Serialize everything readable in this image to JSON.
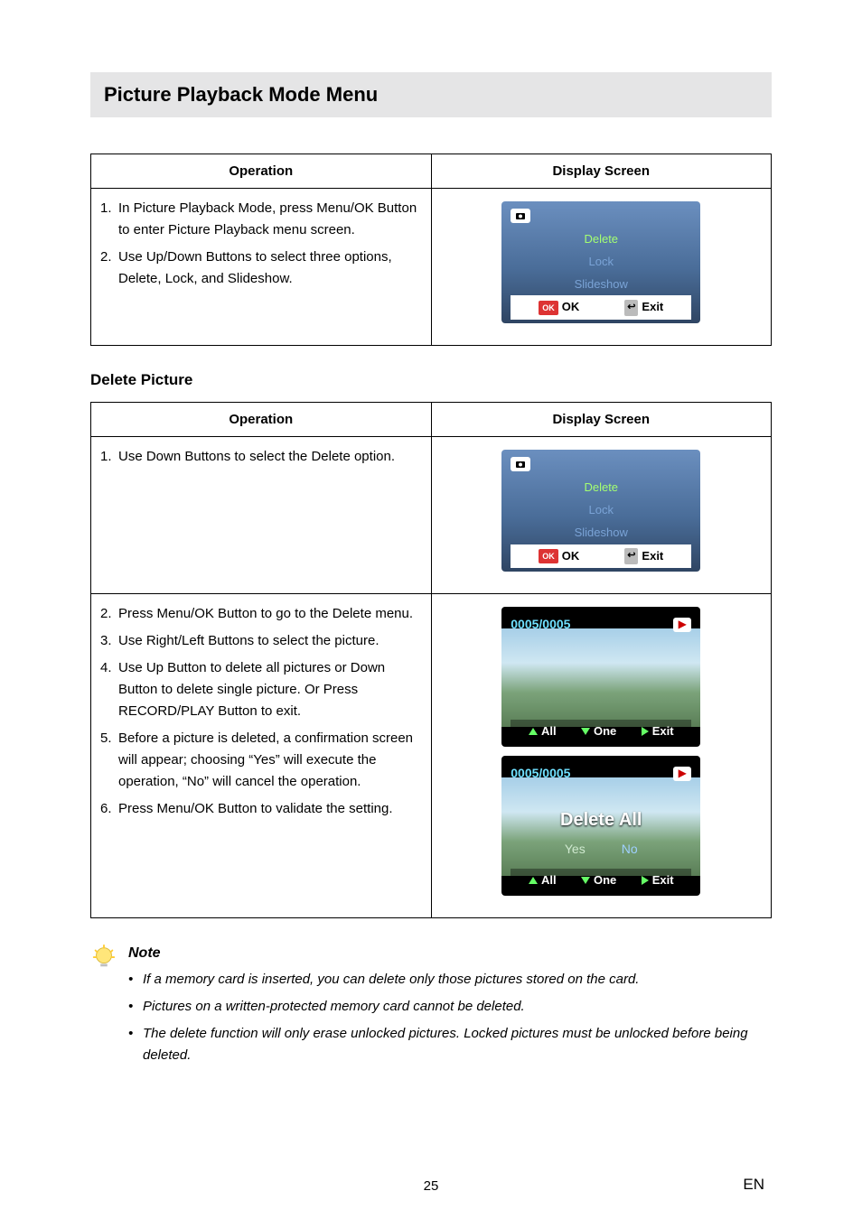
{
  "title": "Picture Playback Mode Menu",
  "headers": {
    "operation": "Operation",
    "display": "Display Screen"
  },
  "table1": {
    "steps": [
      {
        "n": "1.",
        "t": "In Picture Playback Mode, press Menu/OK Button to enter Picture Playback menu screen."
      },
      {
        "n": "2.",
        "t": "Use Up/Down Buttons to select three options, Delete, Lock, and Slideshow."
      }
    ],
    "screen": {
      "menu": [
        "Delete",
        "Lock",
        "Slideshow"
      ],
      "ok": "OK",
      "exit": "Exit",
      "okpill": "OK"
    }
  },
  "sub1": "Delete Picture",
  "table2": {
    "row1": {
      "steps": [
        {
          "n": "1.",
          "t": "Use Down Buttons to select the Delete option."
        }
      ],
      "screen": {
        "menu": [
          "Delete",
          "Lock",
          "Slideshow"
        ],
        "ok": "OK",
        "exit": "Exit",
        "okpill": "OK"
      }
    },
    "row2": {
      "steps": [
        {
          "n": "2.",
          "t": "Press Menu/OK Button to go to the Delete menu."
        },
        {
          "n": "3.",
          "t": "Use Right/Left Buttons to select the picture."
        },
        {
          "n": "4.",
          "t": "Use Up Button to delete all pictures or Down Button to delete single picture. Or Press RECORD/PLAY Button to exit."
        },
        {
          "n": "5.",
          "t": "Before a picture is deleted, a confirmation screen will appear; choosing “Yes” will execute the operation, “No” will cancel the operation."
        },
        {
          "n": "6.",
          "t": "Press Menu/OK Button to validate the setting."
        }
      ],
      "screenA": {
        "counter": "0005/0005",
        "all": "All",
        "one": "One",
        "exit": "Exit"
      },
      "screenB": {
        "counter": "0005/0005",
        "center": "Delete All",
        "yes": "Yes",
        "no": "No",
        "all": "All",
        "one": "One",
        "exit": "Exit"
      }
    }
  },
  "note": {
    "title": "Note",
    "items": [
      "If a memory card is inserted, you can delete only those pictures stored on the card.",
      "Pictures on a written-protected memory card cannot be deleted.",
      "The delete function will only erase unlocked pictures. Locked pictures must be unlocked before being deleted."
    ]
  },
  "footer": {
    "page": "25",
    "lang": "EN"
  }
}
